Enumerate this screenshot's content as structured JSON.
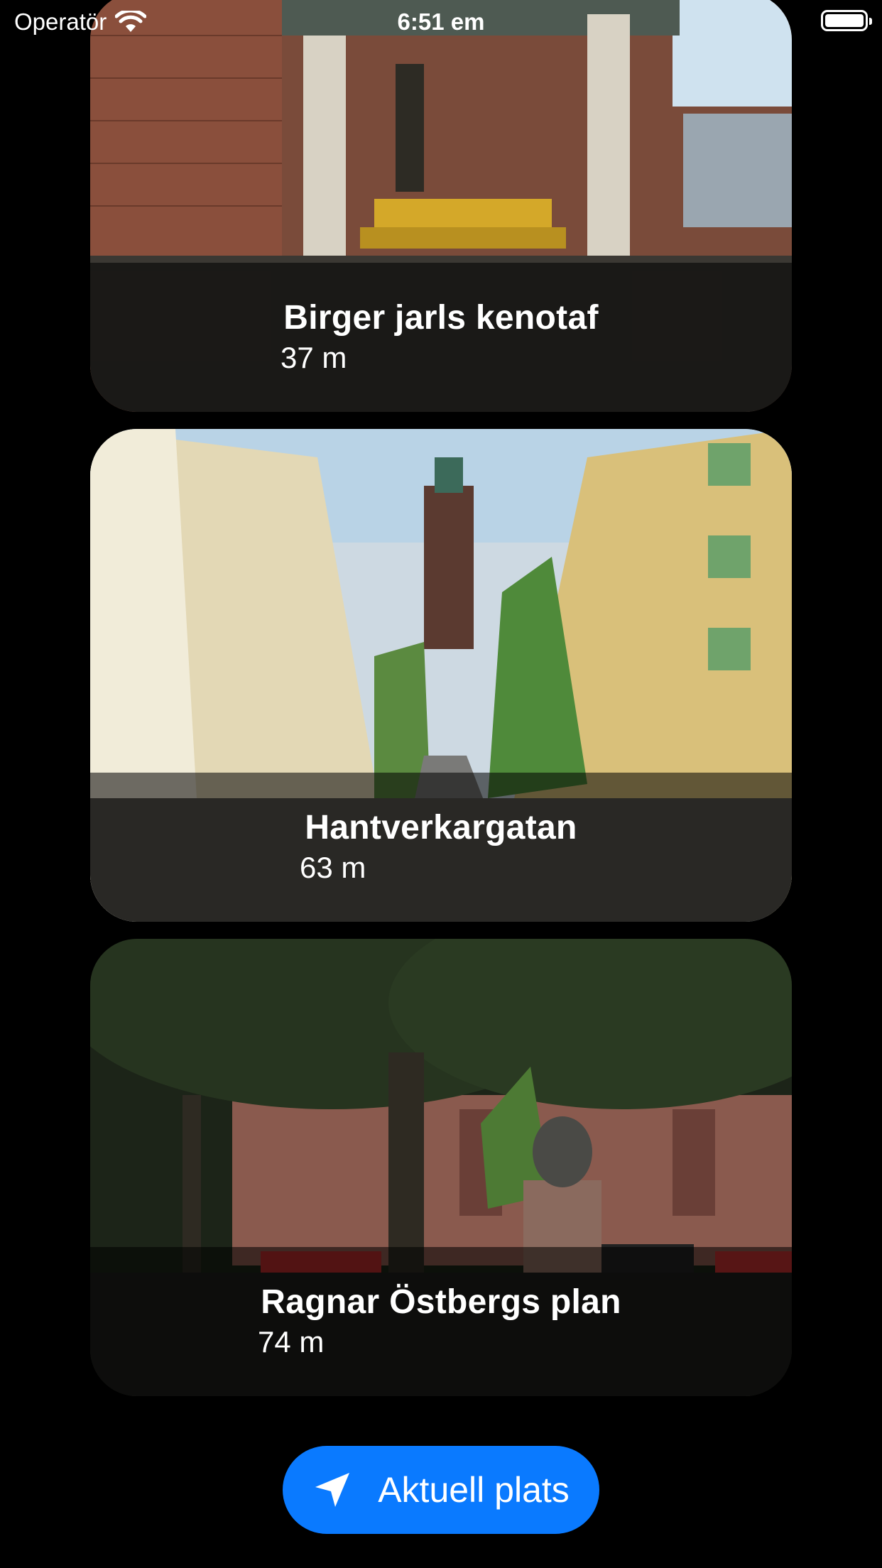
{
  "status_bar": {
    "carrier": "Operatör",
    "time": "6:51 em",
    "wifi_icon": "wifi-icon",
    "battery_icon": "battery-full-icon"
  },
  "places": [
    {
      "name": "Birger jarls kenotaf",
      "distance": "37 m",
      "photo": "cenotaph-photo"
    },
    {
      "name": "Hantverkargatan",
      "distance": "63 m",
      "photo": "street-photo"
    },
    {
      "name": "Ragnar Östbergs plan",
      "distance": "74 m",
      "photo": "plaza-photo"
    }
  ],
  "location_button": {
    "label": "Aktuell plats",
    "icon": "location-arrow-icon",
    "color": "#0a7aff"
  }
}
